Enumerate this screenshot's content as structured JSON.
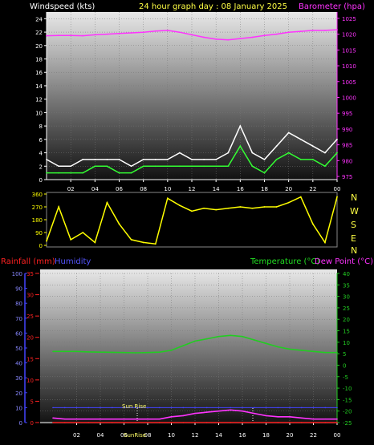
{
  "colors": {
    "background": "#000000",
    "wind": "#ffffff",
    "wind_avg": "#33ff33",
    "barometer": "#ff33ff",
    "direction": "#ffff00",
    "rain": "#ff2222",
    "humidity": "#4444ff",
    "temperature": "#22cc22",
    "dewpoint": "#ff33ff",
    "sunrise_text": "#ffff66",
    "left_labels": "#ff2222"
  },
  "header": {
    "windspeed_label": "Windspeed (kts)",
    "title": "24 hour graph day : 08 January 2025",
    "barometer_label": "Barometer (hpa)"
  },
  "bottom_header": {
    "rainfall_label": "Rainfall (mm)",
    "humidity_label": "Humidity",
    "temperature_label": "Temperature (°C)",
    "dewpoint_label": "Dew Point (°C)"
  },
  "compass": [
    "N",
    "W",
    "S",
    "E",
    "N"
  ],
  "annotations": {
    "sun_rise": "Sun Rise",
    "sun_set": "SunRise"
  },
  "chart_data": [
    {
      "type": "line",
      "x_ticks": [
        "02",
        "04",
        "06",
        "08",
        "10",
        "12",
        "14",
        "16",
        "18",
        "20",
        "22",
        "00"
      ],
      "y_left": {
        "label": "Windspeed (kts)",
        "ticks": [
          0,
          2,
          4,
          6,
          8,
          10,
          12,
          14,
          16,
          18,
          20,
          22,
          24
        ],
        "ylim": [
          0,
          25
        ]
      },
      "y_right": {
        "label": "Barometer (hpa)",
        "ticks": [
          975,
          980,
          985,
          990,
          995,
          1000,
          1005,
          1010,
          1015,
          1020,
          1025
        ],
        "ylim": [
          974,
          1027
        ]
      },
      "x": [
        0,
        1,
        2,
        3,
        4,
        5,
        6,
        7,
        8,
        9,
        10,
        11,
        12,
        13,
        14,
        15,
        16,
        17,
        18,
        19,
        20,
        21,
        22,
        23,
        24
      ],
      "series": [
        {
          "role": "wind_gust",
          "values": [
            3,
            2,
            2,
            3,
            3,
            3,
            3,
            2,
            3,
            3,
            3,
            4,
            3,
            3,
            3,
            4,
            8,
            4,
            3,
            5,
            7,
            6,
            5,
            4,
            6
          ]
        },
        {
          "role": "wind_avg",
          "values": [
            1,
            1,
            1,
            1,
            2,
            2,
            1,
            1,
            2,
            2,
            2,
            2,
            2,
            2,
            2,
            2,
            5,
            2,
            1,
            3,
            4,
            3,
            3,
            2,
            4
          ]
        },
        {
          "role": "barometer",
          "values": [
            1019.5,
            1019.6,
            1019.6,
            1019.5,
            1019.8,
            1020.0,
            1020.2,
            1020.4,
            1020.6,
            1021.0,
            1021.2,
            1020.6,
            1019.8,
            1019.0,
            1018.4,
            1018.2,
            1018.6,
            1019.0,
            1019.6,
            1020.0,
            1020.6,
            1020.9,
            1021.2,
            1021.2,
            1021.4
          ]
        }
      ]
    },
    {
      "type": "line",
      "x_ticks": [],
      "y_left": {
        "ticks": [
          0,
          90,
          180,
          270,
          360
        ],
        "ylim": [
          0,
          360
        ]
      },
      "x": [
        0,
        1,
        2,
        3,
        4,
        5,
        6,
        7,
        8,
        9,
        10,
        11,
        12,
        13,
        14,
        15,
        16,
        17,
        18,
        19,
        20,
        21,
        22,
        23,
        24
      ],
      "series": [
        {
          "role": "wind_direction",
          "values": [
            30,
            270,
            40,
            90,
            20,
            300,
            150,
            40,
            20,
            10,
            330,
            280,
            240,
            260,
            250,
            260,
            270,
            260,
            270,
            270,
            300,
            340,
            150,
            20,
            340
          ]
        }
      ]
    },
    {
      "type": "line",
      "x_ticks": [
        "02",
        "04",
        "06",
        "08",
        "10",
        "12",
        "14",
        "16",
        "18",
        "20",
        "22",
        "00"
      ],
      "y_humidity": {
        "label": "Humidity",
        "ticks": [
          0,
          10,
          20,
          30,
          40,
          50,
          60,
          70,
          80,
          90,
          100
        ],
        "ylim": [
          0,
          100
        ]
      },
      "y_rain": {
        "label": "Rainfall (mm)",
        "ticks": [
          0,
          5,
          10,
          15,
          20,
          25,
          30,
          35
        ],
        "ylim": [
          0,
          35
        ]
      },
      "y_temp": {
        "label": "Temperature (°C)",
        "ticks": [
          -25,
          -20,
          -15,
          -10,
          -5,
          0,
          5,
          10,
          15,
          20,
          25,
          30,
          35,
          40
        ],
        "ylim": [
          -25,
          40
        ]
      },
      "x": [
        0,
        1,
        2,
        3,
        4,
        5,
        6,
        7,
        8,
        9,
        10,
        11,
        12,
        13,
        14,
        15,
        16,
        17,
        18,
        19,
        20,
        21,
        22,
        23,
        24
      ],
      "series": [
        {
          "role": "temperature",
          "values": [
            6,
            6,
            6,
            5.8,
            5.7,
            5.6,
            5.5,
            5.4,
            5.5,
            5.7,
            6.5,
            8.5,
            10.5,
            11.5,
            12.5,
            13,
            12.5,
            11,
            9.5,
            8,
            7,
            6.5,
            6,
            5.5,
            5.5
          ]
        },
        {
          "role": "dewpoint",
          "values": [
            -23,
            -23.5,
            -23.5,
            -23.5,
            -23.5,
            -23.5,
            -23.5,
            -23.5,
            -23.5,
            -23.5,
            -22.5,
            -22,
            -21,
            -20.5,
            -20,
            -19.5,
            -20,
            -21,
            -22,
            -22.5,
            -22.5,
            -23,
            -23.5,
            -23.5,
            -23.5
          ]
        },
        {
          "role": "humidity",
          "values": [
            10,
            10,
            10,
            10,
            10,
            10,
            10,
            10,
            10,
            10,
            10,
            10,
            10,
            10,
            10,
            10,
            10,
            10,
            10,
            10,
            10,
            10,
            10,
            10,
            10
          ]
        },
        {
          "role": "rainfall",
          "values": [
            0,
            0,
            0,
            0,
            0,
            0,
            0,
            0,
            0,
            0,
            0,
            0,
            0,
            0,
            0,
            0,
            0,
            0,
            0,
            0,
            0,
            0,
            0,
            0,
            0
          ]
        }
      ]
    }
  ]
}
